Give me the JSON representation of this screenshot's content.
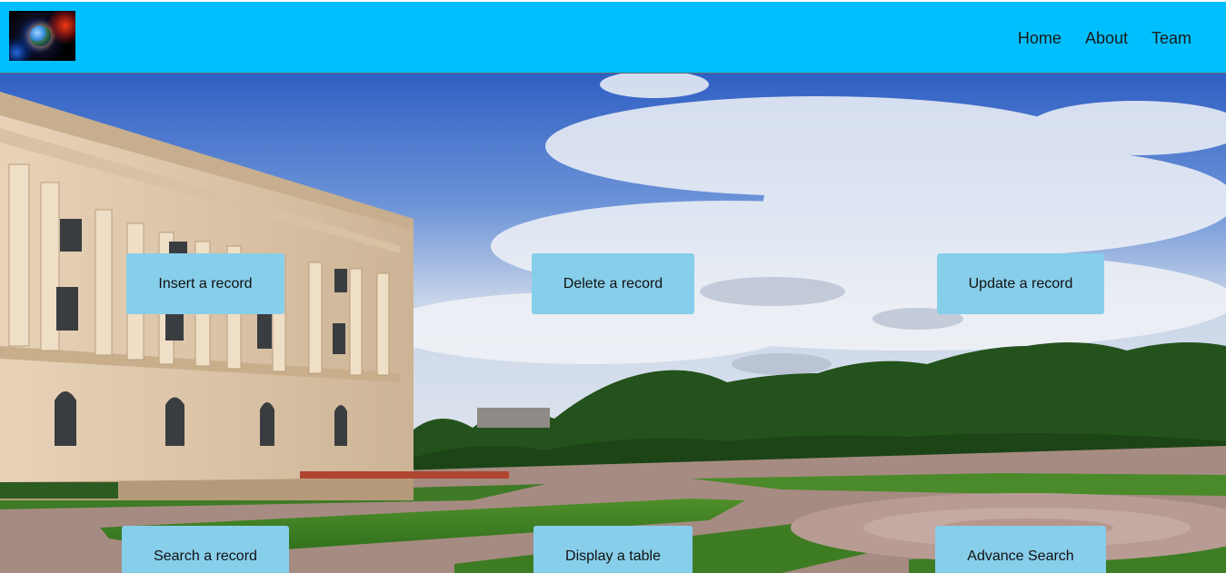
{
  "header": {
    "logo_icon": "earth-flare-logo-icon",
    "background_color": "#00bfff",
    "nav": [
      {
        "label": "Home"
      },
      {
        "label": "About"
      },
      {
        "label": "Team"
      }
    ]
  },
  "hero": {
    "image": "campus-building-sky-photo"
  },
  "actions": {
    "button_color": "#87ceeb",
    "insert": "Insert a record",
    "delete": "Delete a record",
    "update": "Update a record",
    "search": "Search a record",
    "display": "Display a table",
    "advance": "Advance Search"
  }
}
